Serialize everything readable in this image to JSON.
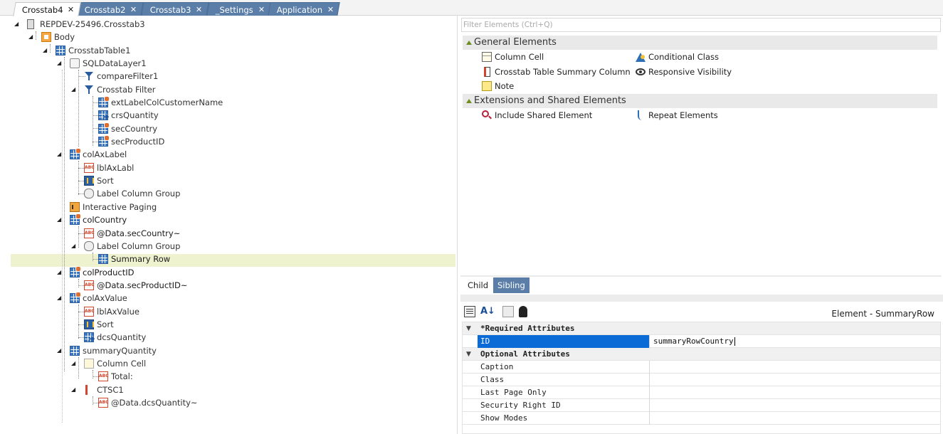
{
  "tabs": [
    {
      "label": "Crosstab4",
      "active": true
    },
    {
      "label": "Crosstab2",
      "active": false
    },
    {
      "label": "Crosstab3",
      "active": false
    },
    {
      "label": "_Settings",
      "active": false
    },
    {
      "label": "Application",
      "active": false
    }
  ],
  "tab_close_glyph": "✕",
  "tree": [
    {
      "label": "REPDEV-25496.Crosstab3",
      "icon": "device-icon"
    },
    {
      "label": "Body",
      "icon": "body-icon"
    },
    {
      "label": "CrosstabTable1",
      "icon": "table-icon"
    },
    {
      "label": "SQLDataLayer1",
      "icon": "datalayer-icon"
    },
    {
      "label": "compareFilter1",
      "icon": "filter-icon"
    },
    {
      "label": "Crosstab Filter",
      "icon": "filter-icon"
    },
    {
      "label": "extLabelColCustomerName",
      "icon": "table-icon"
    },
    {
      "label": "crsQuantity",
      "icon": "calc-column-icon"
    },
    {
      "label": "secCountry",
      "icon": "table-icon"
    },
    {
      "label": "secProductID",
      "icon": "table-icon"
    },
    {
      "label": "colAxLabel",
      "icon": "table-icon"
    },
    {
      "label": "lblAxLabl",
      "icon": "label-icon"
    },
    {
      "label": "Sort",
      "icon": "sort-icon"
    },
    {
      "label": "Label Column Group",
      "icon": "group-icon"
    },
    {
      "label": "Interactive Paging",
      "icon": "paging-icon"
    },
    {
      "label": "colCountry",
      "icon": "table-icon"
    },
    {
      "label": "@Data.secCountry~",
      "icon": "label-icon"
    },
    {
      "label": "Label Column Group",
      "icon": "group-icon"
    },
    {
      "label": "Summary Row",
      "icon": "table-icon"
    },
    {
      "label": "colProductID",
      "icon": "table-icon"
    },
    {
      "label": "@Data.secProductID~",
      "icon": "label-icon"
    },
    {
      "label": "colAxValue",
      "icon": "table-icon"
    },
    {
      "label": "lblAxValue",
      "icon": "label-icon"
    },
    {
      "label": "Sort",
      "icon": "sort-icon"
    },
    {
      "label": "dcsQuantity",
      "icon": "calc-column-icon"
    },
    {
      "label": "summaryQuantity",
      "icon": "table-icon"
    },
    {
      "label": "Column Cell",
      "icon": "column-cell-icon"
    },
    {
      "label": "Total:",
      "icon": "label-icon"
    },
    {
      "label": "CTSC1",
      "icon": "summary-column-icon"
    },
    {
      "label": "@Data.dcsQuantity~",
      "icon": "label-icon"
    }
  ],
  "filter_placeholder": "Filter Elements (Ctrl+Q)",
  "sections": [
    {
      "title": "General Elements",
      "items": [
        {
          "label": "Column Cell",
          "icon": "column-cell-icon"
        },
        {
          "label": "Conditional Class",
          "icon": "conditional-class-icon"
        },
        {
          "label": "Crosstab Table Summary Column",
          "icon": "summary-column-icon"
        },
        {
          "label": "Responsive Visibility",
          "icon": "eye-icon"
        },
        {
          "label": "Note",
          "icon": "note-icon"
        }
      ]
    },
    {
      "title": "Extensions and Shared Elements",
      "items": [
        {
          "label": "Include Shared Element",
          "icon": "include-shared-icon"
        },
        {
          "label": "Repeat Elements",
          "icon": "repeat-icon"
        }
      ]
    }
  ],
  "child_tab": "Child",
  "sibling_tab": "Sibling",
  "toolbar": {
    "categorized_icon": "categorized-icon",
    "sort_icon_text": "A↓",
    "pages_icon": "pages-icon",
    "agent_icon": "agent-icon"
  },
  "element_title": "Element - SummaryRow",
  "attributes": {
    "required_title": "*Required Attributes",
    "required": [
      {
        "name": "ID",
        "value": "summaryRowCountry"
      }
    ],
    "optional_title": "Optional Attributes",
    "optional": [
      {
        "name": "Caption",
        "value": ""
      },
      {
        "name": "Class",
        "value": ""
      },
      {
        "name": "Last Page Only",
        "value": ""
      },
      {
        "name": "Security Right ID",
        "value": ""
      },
      {
        "name": "Show Modes",
        "value": ""
      }
    ]
  },
  "colors": {
    "tab_bg": "#5a7ea8",
    "selection_row": "#eef2cf",
    "selected_attr": "#0a6ad6",
    "section_header": "#e9e9e9"
  }
}
